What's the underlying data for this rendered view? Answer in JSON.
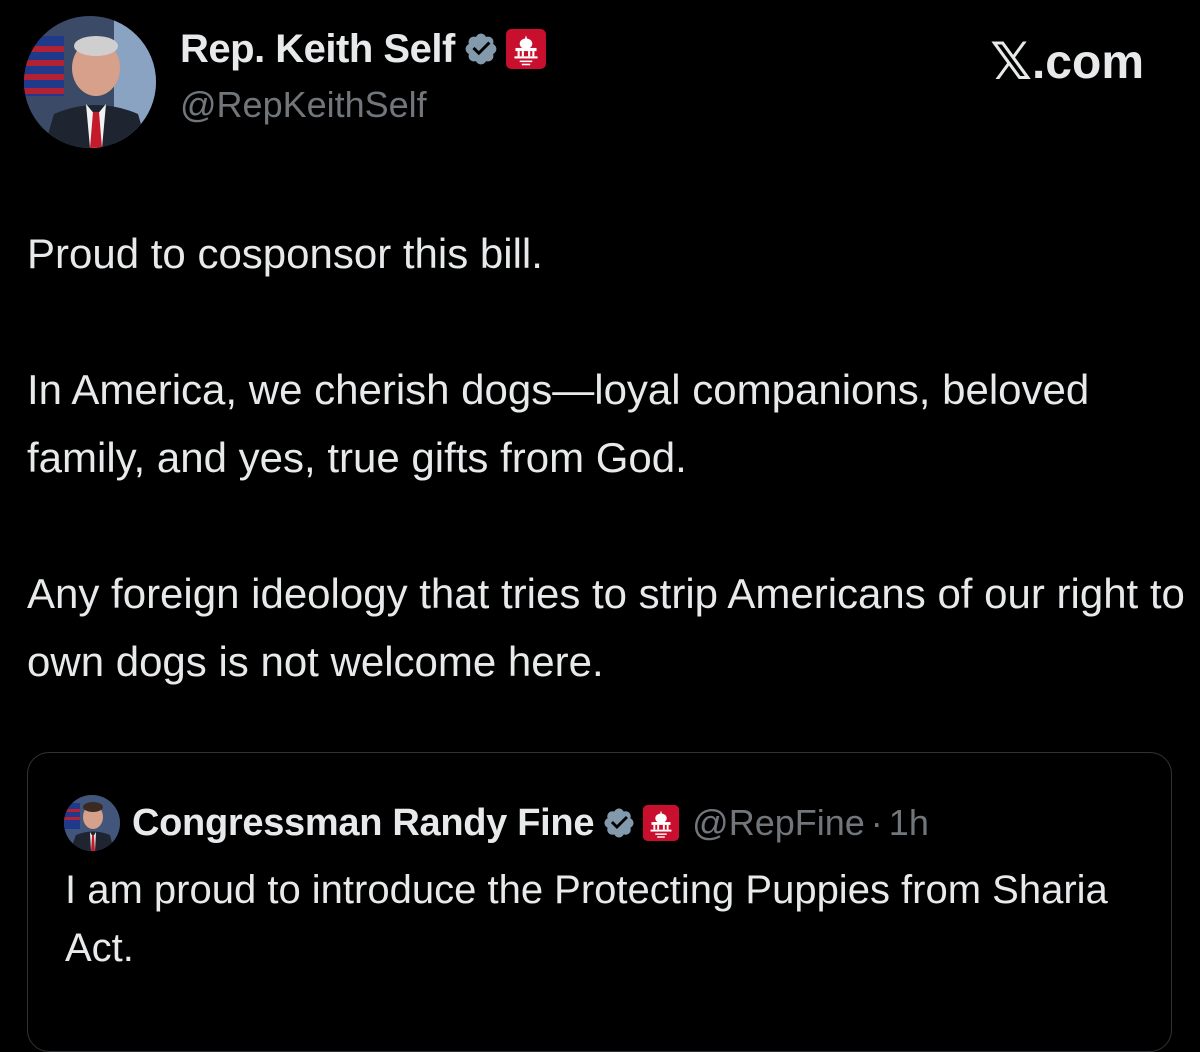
{
  "site": {
    "logo_text": ".com",
    "logo_mark": "𝕏"
  },
  "author": {
    "display_name": "Rep. Keith Self",
    "handle": "@RepKeithSelf",
    "verified_icon": "verified-badge-icon",
    "affiliation_icon": "house-gop-badge-icon",
    "avatar": "avatar-portrait"
  },
  "tweet": {
    "paragraphs": [
      "Proud to cosponsor this bill.",
      "In America, we cherish dogs—loyal companions, beloved family, and yes, true gifts from God.",
      "Any foreign ideology that tries to strip Americans of our right to own dogs is not welcome here."
    ]
  },
  "quoted_tweet": {
    "display_name": "Congressman Randy Fine",
    "handle": "@RepFine",
    "separator": "·",
    "time": "1h",
    "text": "I am proud to introduce the Protecting Puppies from Sharia Act.",
    "verified_icon": "verified-badge-icon",
    "affiliation_icon": "house-gop-badge-icon"
  },
  "colors": {
    "background": "#000000",
    "text_primary": "#e7e9ea",
    "text_secondary": "#71767b",
    "verified_badge": "#829aab",
    "gop_badge": "#c8102e",
    "card_border": "#2f3336"
  }
}
